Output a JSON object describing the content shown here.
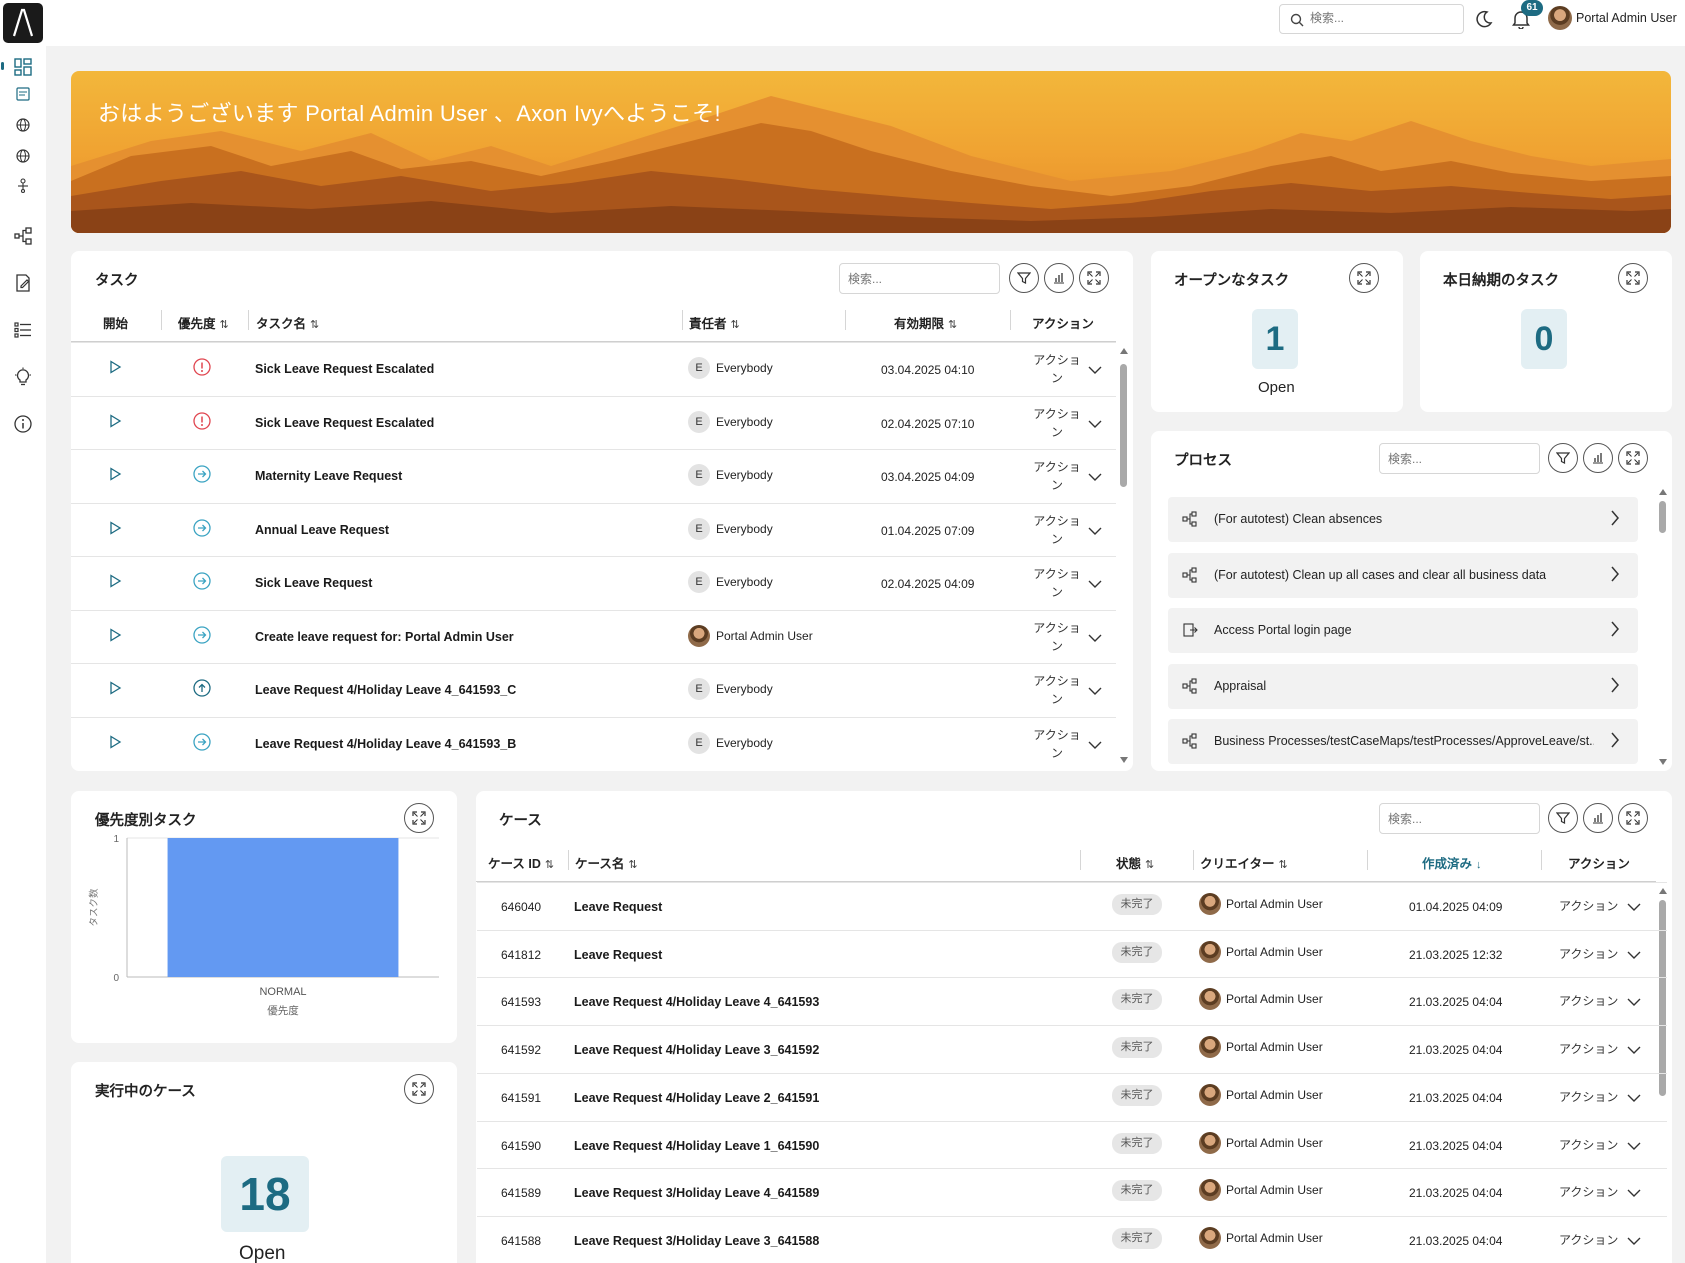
{
  "topbar": {
    "search_placeholder": "検索...",
    "notification_count": "61",
    "user_name": "Portal Admin User"
  },
  "hero": {
    "greeting": "おはようございます Portal Admin User 、Axon Ivyへようこそ!"
  },
  "tasks": {
    "title": "タスク",
    "search_placeholder": "検索...",
    "columns": {
      "start": "開始",
      "priority": "優先度",
      "name": "タスク名",
      "responsible": "責任者",
      "due": "有効期限",
      "actions": "アクション"
    },
    "rows": [
      {
        "name": "Sick Leave Request Escalated",
        "priority": "exception",
        "responsible": "Everybody",
        "initial": "E",
        "due": "03.04.2025 04:10",
        "action": "アクション"
      },
      {
        "name": "Sick Leave Request Escalated",
        "priority": "exception",
        "responsible": "Everybody",
        "initial": "E",
        "due": "02.04.2025 07:10",
        "action": "アクション"
      },
      {
        "name": "Maternity Leave Request",
        "priority": "normal",
        "responsible": "Everybody",
        "initial": "E",
        "due": "03.04.2025 04:09",
        "action": "アクション"
      },
      {
        "name": "Annual Leave Request",
        "priority": "normal",
        "responsible": "Everybody",
        "initial": "E",
        "due": "01.04.2025 07:09",
        "action": "アクション"
      },
      {
        "name": "Sick Leave Request",
        "priority": "normal",
        "responsible": "Everybody",
        "initial": "E",
        "due": "02.04.2025 04:09",
        "action": "アクション"
      },
      {
        "name": "Create leave request for: Portal Admin User",
        "priority": "normal",
        "responsible": "Portal Admin User",
        "initial": "",
        "due": "",
        "action": "アクション"
      },
      {
        "name": "Leave Request 4/Holiday Leave 4_641593_C",
        "priority": "high",
        "responsible": "Everybody",
        "initial": "E",
        "due": "",
        "action": "アクション"
      },
      {
        "name": "Leave Request 4/Holiday Leave 4_641593_B",
        "priority": "normal",
        "responsible": "Everybody",
        "initial": "E",
        "due": "",
        "action": "アクション"
      }
    ]
  },
  "open_tasks": {
    "title": "オープンなタスク",
    "count": "1",
    "label": "Open"
  },
  "due_today": {
    "title": "本日納期のタスク",
    "count": "0"
  },
  "processes": {
    "title": "プロセス",
    "search_placeholder": "検索...",
    "items": [
      {
        "label": "(For autotest) Clean absences",
        "icon": "process-icon"
      },
      {
        "label": "(For autotest) Clean up all cases and clear all business data",
        "icon": "process-icon"
      },
      {
        "label": "Access Portal login page",
        "icon": "external-link-icon"
      },
      {
        "label": "Appraisal",
        "icon": "process-icon"
      },
      {
        "label": "Business Processes/testCaseMaps/testProcesses/ApproveLeave/st...",
        "icon": "process-icon"
      }
    ]
  },
  "priority_chart": {
    "title": "優先度別タスク"
  },
  "chart_data": {
    "type": "bar",
    "categories": [
      "NORMAL"
    ],
    "values": [
      1
    ],
    "xlabel": "優先度",
    "ylabel": "タスク数",
    "ylim": [
      0,
      1
    ],
    "yticks": [
      "0",
      "1"
    ],
    "color": "#6399f2"
  },
  "running_cases": {
    "title": "実行中のケース",
    "count": "18",
    "label": "Open"
  },
  "cases": {
    "title": "ケース",
    "search_placeholder": "検索...",
    "columns": {
      "id": "ケース ID",
      "name": "ケース名",
      "state": "状態",
      "creator": "クリエイター",
      "created": "作成済み",
      "actions": "アクション"
    },
    "rows": [
      {
        "id": "646040",
        "name": "Leave Request",
        "state": "未完了",
        "creator": "Portal Admin User",
        "created": "01.04.2025 04:09",
        "action": "アクション"
      },
      {
        "id": "641812",
        "name": "Leave Request",
        "state": "未完了",
        "creator": "Portal Admin User",
        "created": "21.03.2025 12:32",
        "action": "アクション"
      },
      {
        "id": "641593",
        "name": "Leave Request 4/Holiday Leave 4_641593",
        "state": "未完了",
        "creator": "Portal Admin User",
        "created": "21.03.2025 04:04",
        "action": "アクション"
      },
      {
        "id": "641592",
        "name": "Leave Request 4/Holiday Leave 3_641592",
        "state": "未完了",
        "creator": "Portal Admin User",
        "created": "21.03.2025 04:04",
        "action": "アクション"
      },
      {
        "id": "641591",
        "name": "Leave Request 4/Holiday Leave 2_641591",
        "state": "未完了",
        "creator": "Portal Admin User",
        "created": "21.03.2025 04:04",
        "action": "アクション"
      },
      {
        "id": "641590",
        "name": "Leave Request 4/Holiday Leave 1_641590",
        "state": "未完了",
        "creator": "Portal Admin User",
        "created": "21.03.2025 04:04",
        "action": "アクション"
      },
      {
        "id": "641589",
        "name": "Leave Request 3/Holiday Leave 4_641589",
        "state": "未完了",
        "creator": "Portal Admin User",
        "created": "21.03.2025 04:04",
        "action": "アクション"
      },
      {
        "id": "641588",
        "name": "Leave Request 3/Holiday Leave 3_641588",
        "state": "未完了",
        "creator": "Portal Admin User",
        "created": "21.03.2025 04:04",
        "action": "アクション"
      }
    ]
  },
  "colors": {
    "accent": "#1d6b82",
    "danger": "#e0454f",
    "info": "#3aa3c2",
    "chart_bar": "#6399f2"
  }
}
